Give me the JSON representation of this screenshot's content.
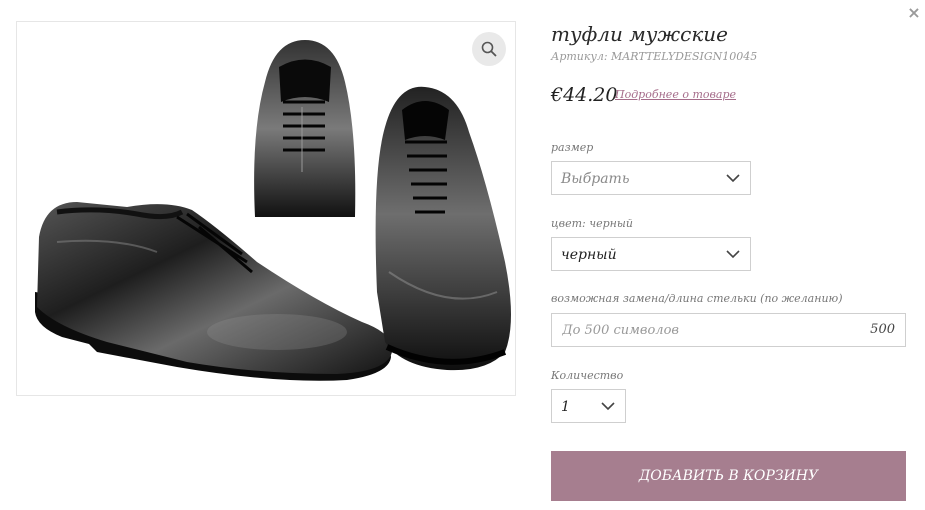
{
  "product": {
    "title": "туфли мужские",
    "sku": "Артикул: MARTTELYDESIGN10045",
    "price": "€44.20",
    "details_link": "Подробнее о товаре"
  },
  "options": {
    "size": {
      "label": "размер",
      "selected": "Выбрать"
    },
    "color": {
      "label": "цвет: черный",
      "selected": "черный"
    },
    "insole": {
      "label": "возможная замена/длина стельки (по желанию)",
      "placeholder": "До 500 символов",
      "counter": "500"
    },
    "quantity": {
      "label": "Количество",
      "selected": "1"
    }
  },
  "actions": {
    "close": "×",
    "add_to_cart": "ДОБАВИТЬ В КОРЗИНУ"
  },
  "colors": {
    "accent_button": "#a67e8f",
    "link": "#a56c8a"
  },
  "icons": {
    "zoom": "magnifier-icon",
    "close": "close-icon",
    "dropdown": "chevron-down-icon"
  }
}
